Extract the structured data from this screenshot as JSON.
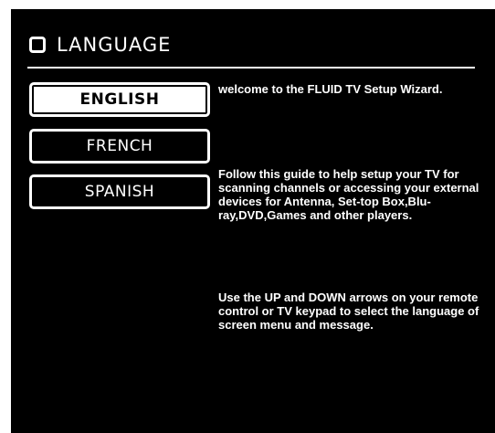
{
  "header": {
    "title": "LANGUAGE",
    "icon": "square-outline-icon"
  },
  "languages": {
    "items": [
      {
        "label": "ENGLISH",
        "selected": true
      },
      {
        "label": "FRENCH",
        "selected": false
      },
      {
        "label": "SPANISH",
        "selected": false
      }
    ]
  },
  "info": {
    "welcome": "welcome to the FLUID TV Setup Wizard.",
    "guide": "Follow this guide to help setup your TV for scanning channels or accessing your external devices for Antenna, Set-top Box,Blu-ray,DVD,Games and other players.",
    "howto": "Use the UP and DOWN arrows on your remote control or TV keypad to select the language of screen menu and message."
  },
  "colors": {
    "background": "#000000",
    "foreground": "#ffffff",
    "outer": "#ffffff"
  }
}
